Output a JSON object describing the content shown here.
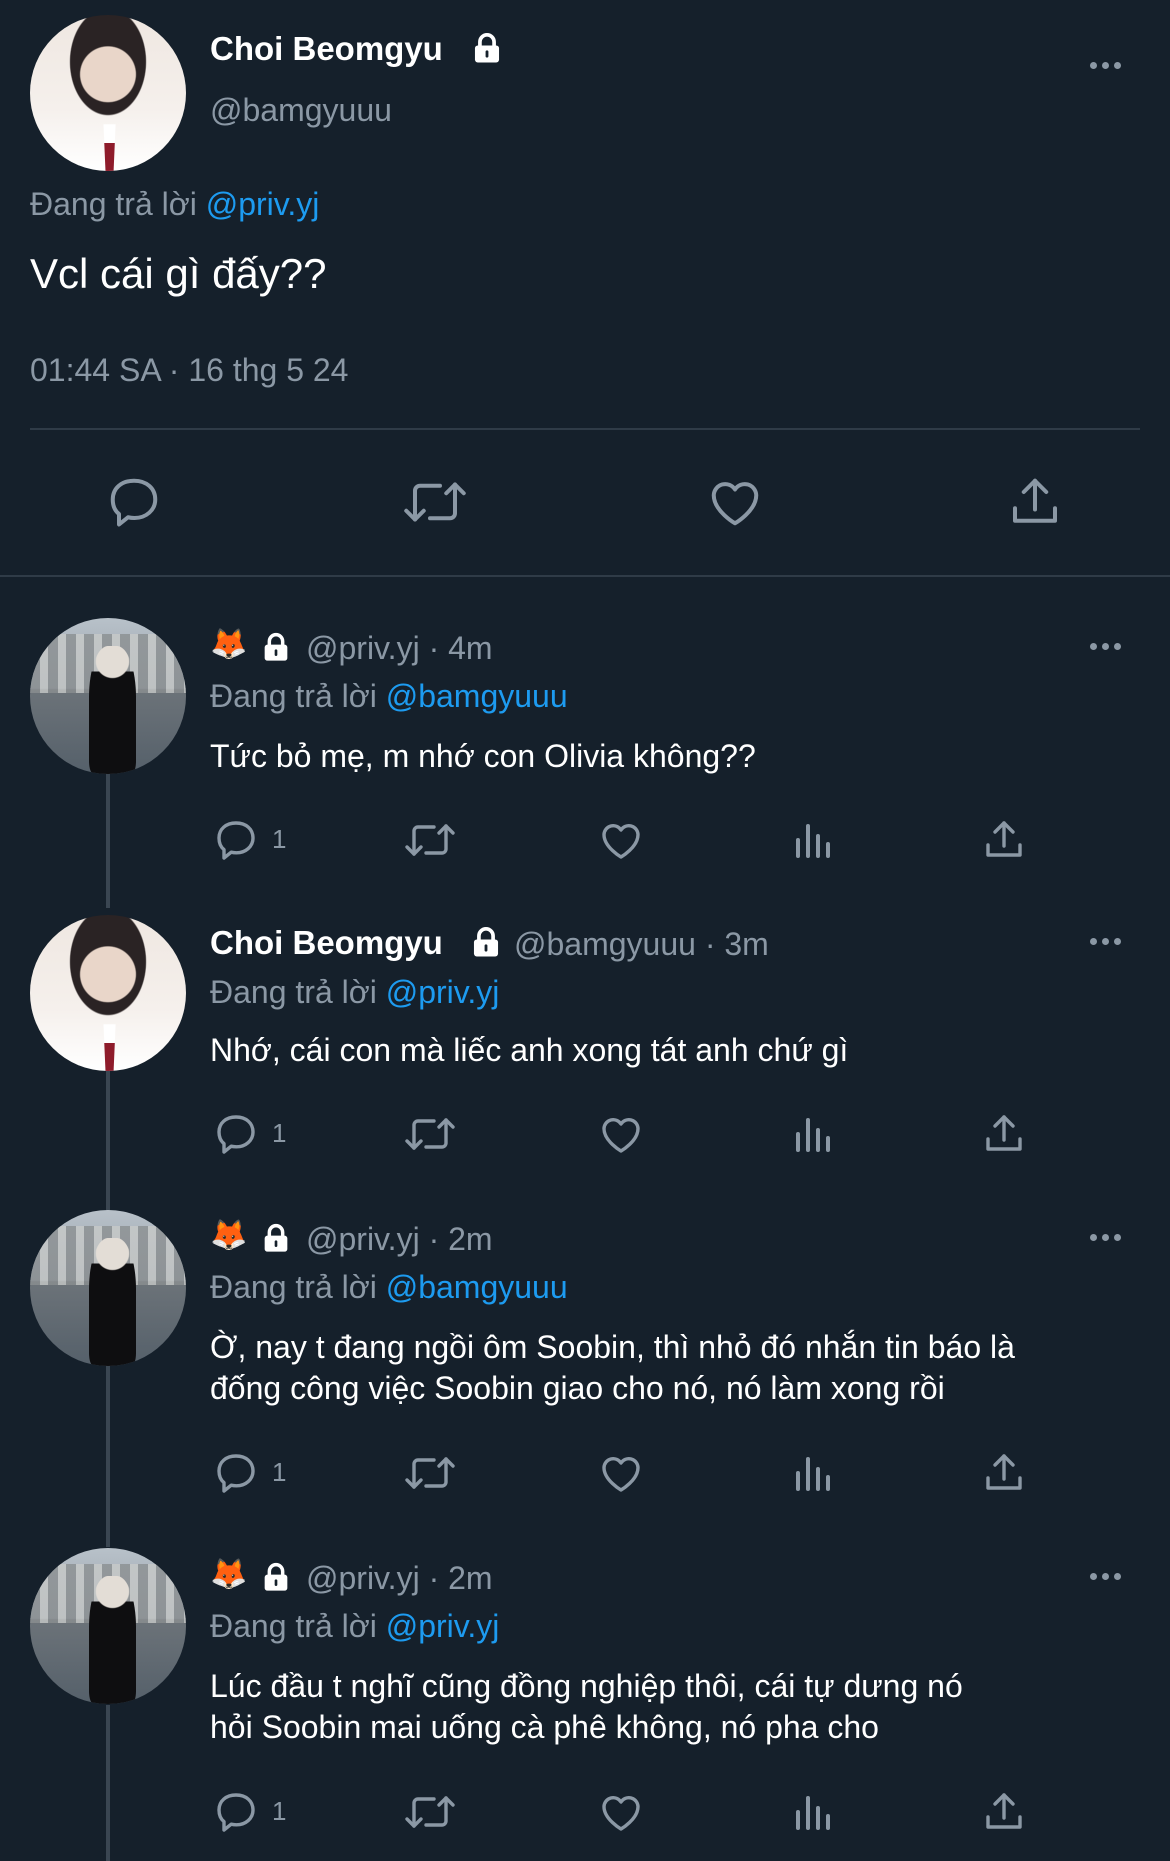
{
  "main_tweet": {
    "display_name": "Choi Beomgyu",
    "handle": "@bamgyuuu",
    "reply_prefix": "Đang trả lời",
    "reply_to": "@priv.yj",
    "text": "Vcl cái gì đấy??",
    "timestamp": "01:44 SA · 16 thg 5 24"
  },
  "replies": [
    {
      "display_name": "🦊",
      "handle": "@priv.yj",
      "time": "· 4m",
      "reply_prefix": "Đang trả lời",
      "reply_to": "@bamgyuuu",
      "text_lines": [
        "Tức bỏ mẹ, m nhớ con Olivia không??"
      ],
      "reply_count": "1"
    },
    {
      "display_name": "Choi Beomgyu",
      "handle": "@bamgyuuu",
      "time": "· 3m",
      "reply_prefix": "Đang trả lời",
      "reply_to": "@priv.yj",
      "text_lines": [
        "Nhớ, cái con mà liếc anh xong tát anh chứ gì"
      ],
      "reply_count": "1"
    },
    {
      "display_name": "🦊",
      "handle": "@priv.yj",
      "time": "· 2m",
      "reply_prefix": "Đang trả lời",
      "reply_to": "@bamgyuuu",
      "text_lines": [
        "Ờ, nay t đang ngồi ôm Soobin, thì nhỏ đó nhắn tin báo là",
        "đống công việc Soobin giao cho nó, nó làm xong rồi"
      ],
      "reply_count": "1"
    },
    {
      "display_name": "🦊",
      "handle": "@priv.yj",
      "time": "· 2m",
      "reply_prefix": "Đang trả lời",
      "reply_to": "@priv.yj",
      "text_lines": [
        "Lúc đầu t nghĩ cũng đồng nghiệp thôi, cái tự dưng nó",
        "hỏi Soobin mai uống cà phê không, nó pha cho"
      ],
      "reply_count": "1"
    }
  ],
  "icons": [
    "more-icon",
    "lock-icon",
    "reply-icon",
    "retweet-icon",
    "like-icon",
    "views-icon",
    "share-icon"
  ]
}
